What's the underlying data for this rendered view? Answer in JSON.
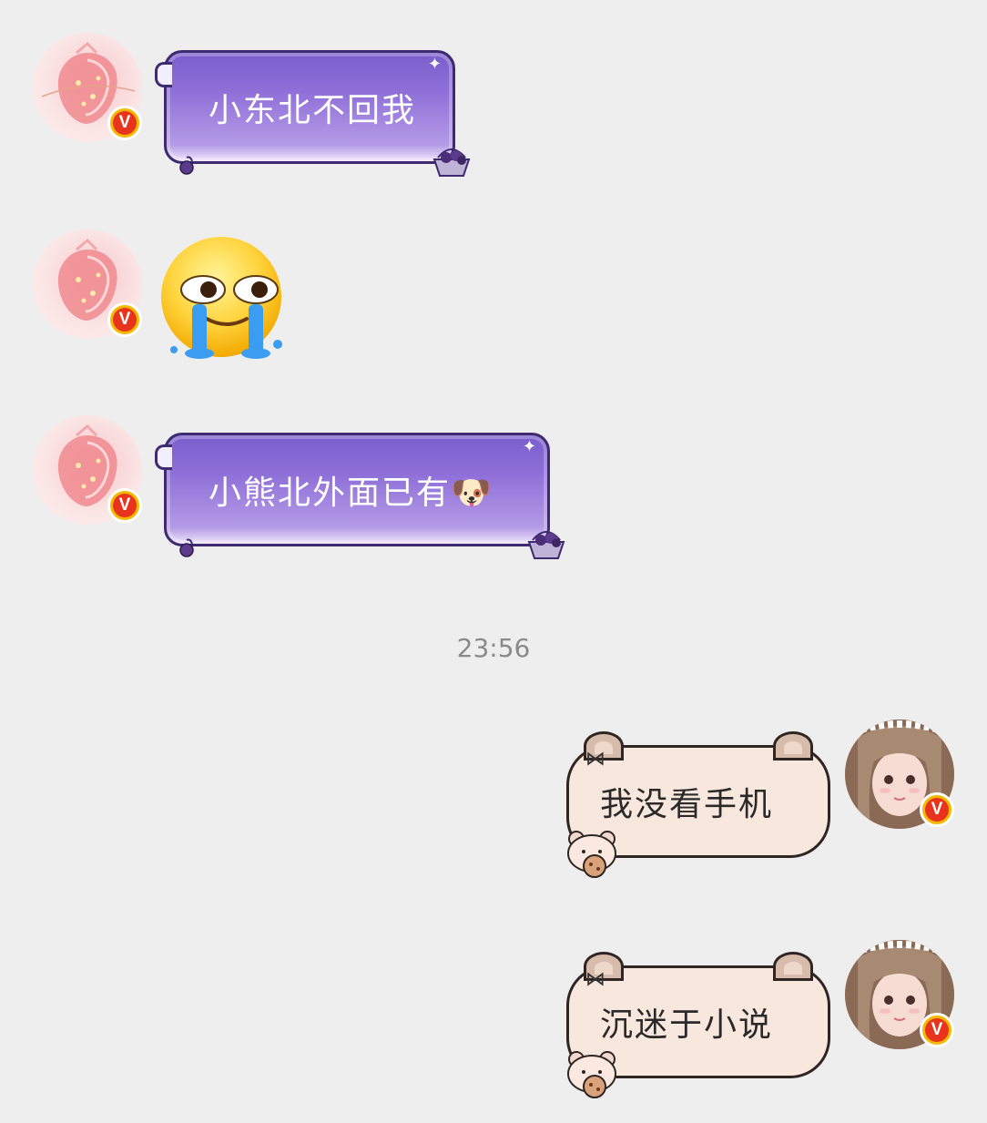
{
  "conversation": {
    "messages": [
      {
        "side": "left",
        "type": "text",
        "text": "小东北不回我"
      },
      {
        "side": "left",
        "type": "sticker",
        "sticker": "crying-laughing-emoji"
      },
      {
        "side": "left",
        "type": "text",
        "text": "小熊北外面已有🐶"
      },
      {
        "side": "right",
        "type": "text",
        "text": "我没看手机"
      },
      {
        "side": "right",
        "type": "text",
        "text": "沉迷于小说"
      }
    ],
    "timestamp": "23:56"
  },
  "badges": {
    "verified_symbol": "V"
  },
  "colors": {
    "background": "#eeeeee",
    "purple_bubble": "#8e6fd8",
    "cream_bubble": "#f8e7dc",
    "badge_gold": "#f5b800",
    "badge_red": "#e8341c"
  }
}
